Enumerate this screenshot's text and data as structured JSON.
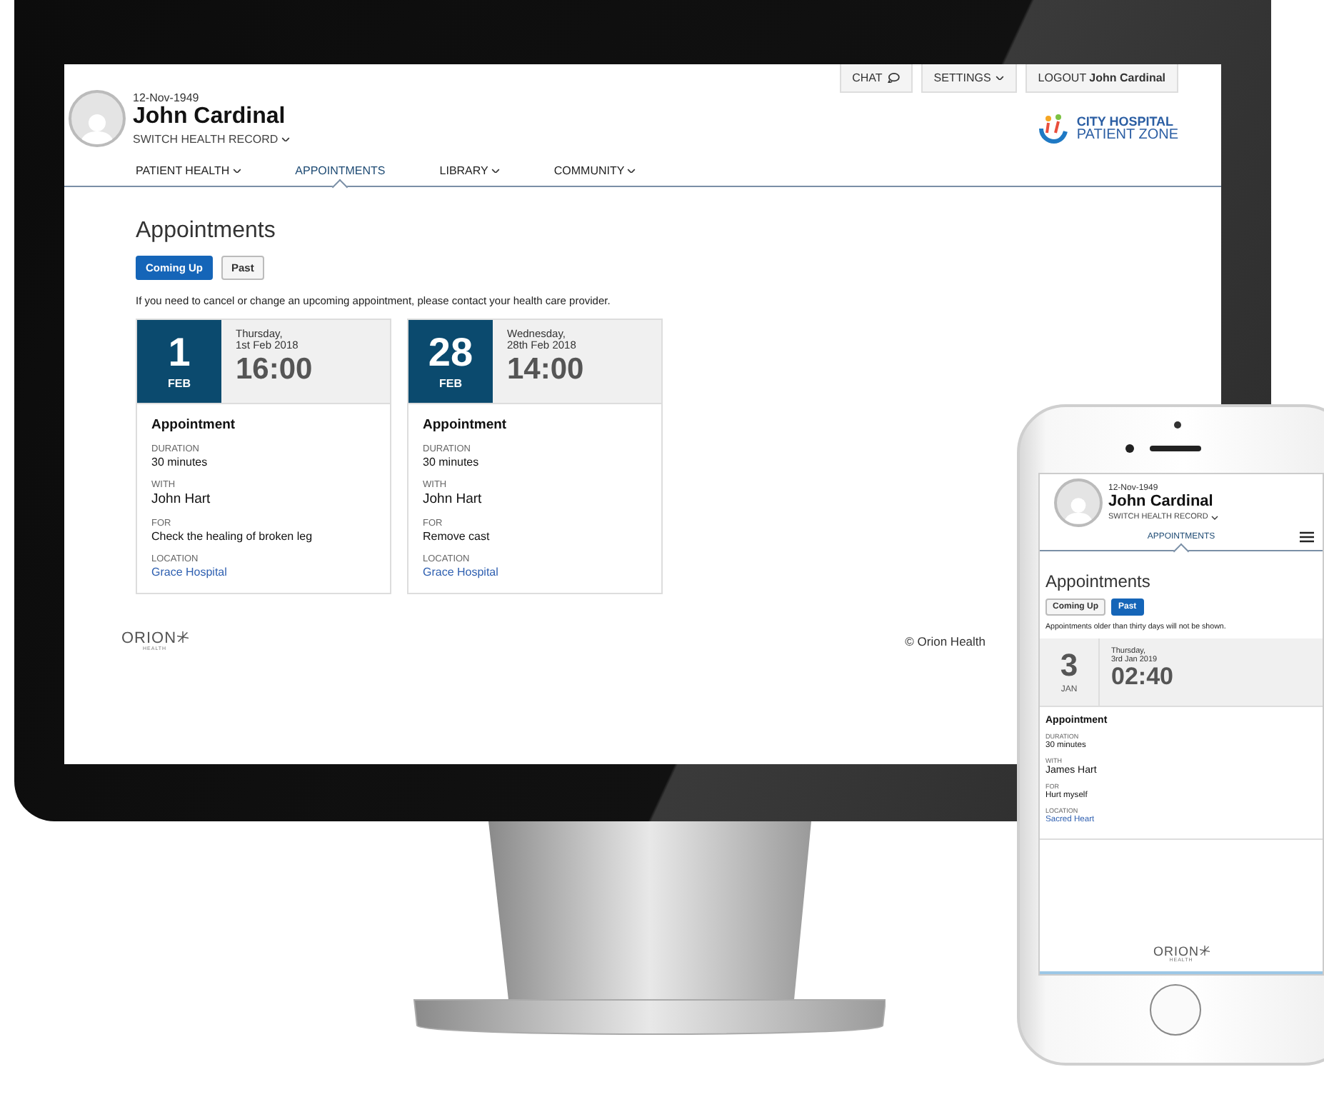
{
  "desktop": {
    "header": {
      "birth_date": "12-Nov-1949",
      "name": "John Cardinal",
      "switch_record": "SWITCH HEALTH RECORD",
      "top_buttons": [
        {
          "label": "CHAT",
          "kind": "chat"
        },
        {
          "label": "SETTINGS",
          "kind": "menu"
        },
        {
          "label": "LOGOUT **John Cardinal**",
          "kind": "plain"
        }
      ],
      "brand": {
        "line_1": "CITY HOSPITAL",
        "line_2": "PATIENT ZONE"
      }
    },
    "nav": [
      {
        "label": "PATIENT HEALTH",
        "has_menu": true,
        "selected": false
      },
      {
        "label": "APPOINTMENTS",
        "has_menu": false,
        "selected": true
      },
      {
        "label": "LIBRARY",
        "has_menu": true,
        "selected": false
      },
      {
        "label": "COMMUNITY",
        "has_menu": true,
        "selected": false
      }
    ],
    "page_title": "Appointments",
    "filters": [
      {
        "label": "Coming Up",
        "selected": true
      },
      {
        "label": "Past",
        "selected": false
      }
    ],
    "notice": "If you need to cancel or change an upcoming appointment, please contact your health care provider.",
    "appointments": [
      {
        "day": "1",
        "month": "FEB",
        "weekday": "Thursday,",
        "date": "1st Feb 2018",
        "time": "16:00",
        "title": "Appointment",
        "fields": [
          {
            "label": "DURATION",
            "value": "30 minutes",
            "kind": "text"
          },
          {
            "label": "WITH",
            "value": "John Hart",
            "kind": "person"
          },
          {
            "label": "FOR",
            "value": "Check the healing of broken leg",
            "kind": "text"
          },
          {
            "label": "LOCATION",
            "value": "Grace Hospital",
            "kind": "link"
          }
        ]
      },
      {
        "day": "28",
        "month": "FEB",
        "weekday": "Wednesday,",
        "date": "28th Feb 2018",
        "time": "14:00",
        "title": "Appointment",
        "fields": [
          {
            "label": "DURATION",
            "value": "30 minutes",
            "kind": "text"
          },
          {
            "label": "WITH",
            "value": "John Hart",
            "kind": "person"
          },
          {
            "label": "FOR",
            "value": "Remove cast",
            "kind": "text"
          },
          {
            "label": "LOCATION",
            "value": "Grace Hospital",
            "kind": "link"
          }
        ]
      }
    ],
    "footer": {
      "logo": "ORION",
      "logo_sub": "HEALTH",
      "copyright": "© Orion Health"
    }
  },
  "mobile": {
    "header": {
      "birth_date": "12-Nov-1949",
      "name": "John Cardinal",
      "switch_record": "SWITCH HEALTH RECORD"
    },
    "nav": [
      {
        "label": "APPOINTMENTS",
        "selected": true
      }
    ],
    "page_title": "Appointments",
    "filters": [
      {
        "label": "Coming Up",
        "selected": false
      },
      {
        "label": "Past",
        "selected": true
      }
    ],
    "notice": "Appointments older than thirty days will not be shown.",
    "appointments": [
      {
        "day": "3",
        "month": "JAN",
        "weekday": "Thursday,",
        "date": "3rd Jan 2019",
        "time": "02:40",
        "title": "Appointment",
        "fields": [
          {
            "label": "DURATION",
            "value": "30 minutes",
            "kind": "text"
          },
          {
            "label": "WITH",
            "value": "James Hart",
            "kind": "person"
          },
          {
            "label": "FOR",
            "value": "Hurt myself",
            "kind": "text"
          },
          {
            "label": "LOCATION",
            "value": "Sacred Heart",
            "kind": "link"
          }
        ]
      }
    ],
    "footer": {
      "logo": "ORION",
      "logo_sub": "HEALTH"
    }
  }
}
